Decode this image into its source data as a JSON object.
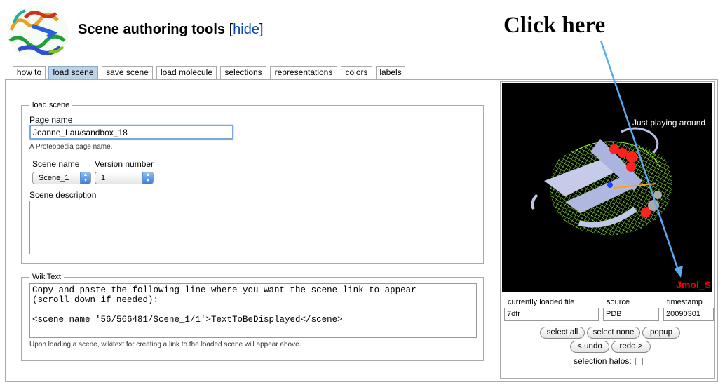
{
  "header": {
    "title": "Scene authoring tools",
    "hide_open": "[",
    "hide_link": "hide",
    "hide_close": "]"
  },
  "annotation": "Click here",
  "tabs": [
    {
      "label": "how to"
    },
    {
      "label": "load scene",
      "active": true
    },
    {
      "label": "save scene"
    },
    {
      "label": "load molecule"
    },
    {
      "label": "selections"
    },
    {
      "label": "representations"
    },
    {
      "label": "colors"
    },
    {
      "label": "labels"
    }
  ],
  "load_scene": {
    "legend": "load scene",
    "page_name_label": "Page name",
    "page_name_value": "Joanne_Lau/sandbox_18",
    "page_name_hint": "A Proteopedia page name.",
    "scene_name_label": "Scene name",
    "scene_name_value": "Scene_1",
    "version_label": "Version number",
    "version_value": "1",
    "description_label": "Scene description"
  },
  "wikitext": {
    "legend": "WikiText",
    "content": "Copy and paste the following line where you want the scene link to appear\n(scroll down if needed):\n\n<scene name='56/566481/Scene_1/1'>TextToBeDisplayed</scene>",
    "hint": "Upon loading a scene, wikitext for creating a link to the loaded scene will appear above."
  },
  "jmol": {
    "label": "Just playing around",
    "brand": "Jmol_S"
  },
  "file_info": {
    "file_label": "currently loaded file",
    "file_value": "7dfr",
    "source_label": "source",
    "source_value": "PDB",
    "timestamp_label": "timestamp",
    "timestamp_value": "20090301"
  },
  "buttons": {
    "select_all": "select all",
    "select_none": "select none",
    "popup": "popup",
    "undo": "< undo",
    "redo": "redo >"
  },
  "selection_halos_label": "selection halos:",
  "colors": {
    "accent_tab": "#bcd3e8",
    "link": "#0645ad",
    "annotation_arrow": "#5aaaf0",
    "mesh": "#9cff30"
  }
}
